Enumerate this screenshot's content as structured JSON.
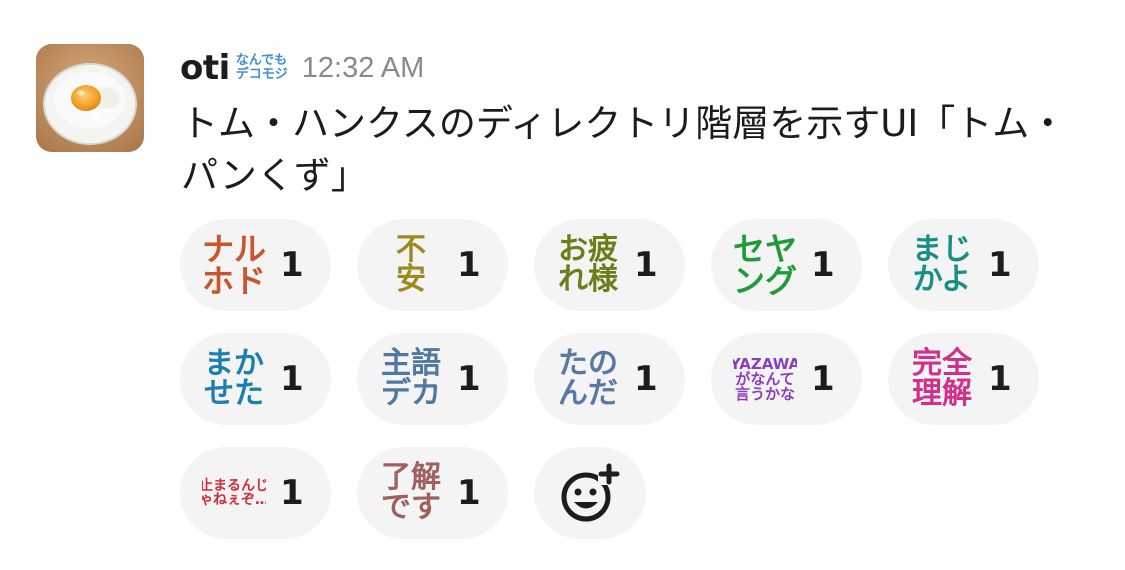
{
  "message": {
    "username": "oti",
    "status_emoji": {
      "line1": "なんでも",
      "line2": "デコモジ",
      "color": "#3e8fd8"
    },
    "timestamp": "12:32 AM",
    "text": "トム・ハンクスのディレクトリ階層を示すUI「トム・パンくず」"
  },
  "avatar": {
    "icon": "egg-rice-bowl-photo"
  },
  "reactions": [
    {
      "name": "naruhodo",
      "lines": [
        "ナル",
        "ホド"
      ],
      "color": "#c8552b",
      "size": 32,
      "count": "1"
    },
    {
      "name": "fuan",
      "lines": [
        "不",
        "安"
      ],
      "color": "#9d8a1e",
      "size": 30,
      "count": "1"
    },
    {
      "name": "otsukaresama",
      "lines": [
        "お疲",
        "れ様"
      ],
      "color": "#6e7d1b",
      "size": 30,
      "count": "1"
    },
    {
      "name": "seyangu",
      "lines": [
        "セヤ",
        "ング"
      ],
      "color": "#1f9b3a",
      "size": 32,
      "count": "1"
    },
    {
      "name": "majikayo",
      "lines": [
        "まじ",
        "かよ"
      ],
      "color": "#178f83",
      "size": 30,
      "count": "1"
    },
    {
      "name": "makaseta",
      "lines": [
        "まか",
        "せた"
      ],
      "color": "#1c7fb0",
      "size": 30,
      "count": "1"
    },
    {
      "name": "shugodeka",
      "lines": [
        "主語",
        "デカ"
      ],
      "color": "#4f79a3",
      "size": 30,
      "count": "1"
    },
    {
      "name": "tanonda",
      "lines": [
        "たの",
        "んだ"
      ],
      "color": "#5879a6",
      "size": 30,
      "count": "1"
    },
    {
      "name": "yazawa",
      "lines": [
        "YAZAWA",
        "がなんて",
        "言うかな"
      ],
      "color": "#8b3ec2",
      "size": 15,
      "count": "1"
    },
    {
      "name": "kanzenrikai",
      "lines": [
        "完全",
        "理解"
      ],
      "color": "#d1318a",
      "size": 30,
      "count": "1"
    },
    {
      "name": "tomarunjane",
      "lines": [
        "止まるんじ",
        "ゃねぇぞ…"
      ],
      "color": "#d22c38",
      "size": 14,
      "count": "1"
    },
    {
      "name": "ryoukaidesu",
      "lines": [
        "了解",
        "です"
      ],
      "color": "#a06060",
      "size": 30,
      "count": "1"
    }
  ],
  "add_reaction": {
    "icon": "add-reaction-icon"
  }
}
